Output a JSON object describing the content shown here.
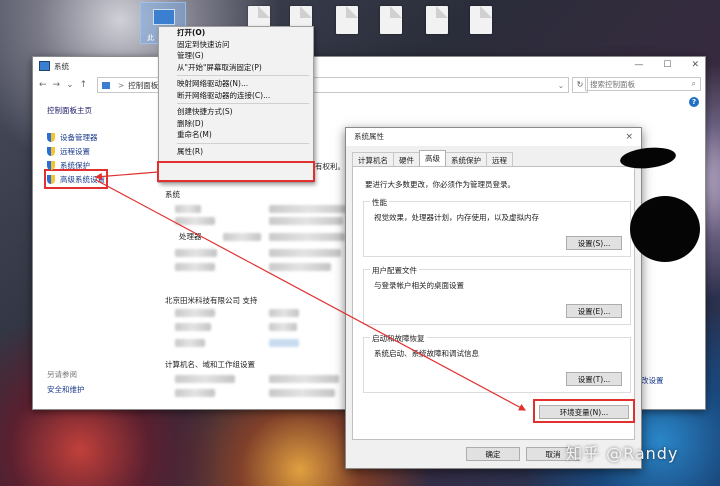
{
  "desktop": {
    "pc_label": "此"
  },
  "main_window": {
    "title": "系统",
    "address": {
      "root": "控制面板",
      "sep": ">"
    },
    "search_placeholder": "搜索控制面板",
    "sidebar": {
      "home": "控制面板主页",
      "items": [
        "设备管理器",
        "远程设置",
        "系统保护",
        "高级系统设置"
      ],
      "see_also": "另请参阅",
      "security": "安全和维护"
    },
    "content": {
      "rights_fragment": "有权利。",
      "system_heading": "系统",
      "processor_label": "处理器",
      "support_label": "北京田米科技有限公司 支持",
      "computer_heading": "计算机名、域和工作组设置",
      "change_settings_fragment": "改设置"
    }
  },
  "context_menu": {
    "items": [
      {
        "label": "打开(O)",
        "bold": true
      },
      {
        "label": "固定到快速访问"
      },
      {
        "label": "管理(G)"
      },
      {
        "label": "从\"开始\"屏幕取消固定(P)"
      },
      {
        "sep": true
      },
      {
        "label": "映射网络驱动器(N)..."
      },
      {
        "label": "断开网络驱动器的连接(C)..."
      },
      {
        "sep": true
      },
      {
        "label": "创建快捷方式(S)"
      },
      {
        "label": "删除(D)"
      },
      {
        "label": "重命名(M)"
      },
      {
        "sep": true
      },
      {
        "label": "属性(R)"
      }
    ]
  },
  "dialog": {
    "title": "系统属性",
    "close": "×",
    "tabs": [
      "计算机名",
      "硬件",
      "高级",
      "系统保护",
      "远程"
    ],
    "active_tab": "高级",
    "note": "要进行大多数更改，你必须作为管理员登录。",
    "performance": {
      "title": "性能",
      "desc": "视觉效果，处理器计划，内存使用，以及虚拟内存",
      "button": "设置(S)..."
    },
    "profile": {
      "title": "用户配置文件",
      "desc": "与登录帐户相关的桌面设置",
      "button": "设置(E)..."
    },
    "startup": {
      "title": "启动和故障恢复",
      "desc": "系统启动、系统故障和调试信息",
      "button": "设置(T)..."
    },
    "env_button": "环境变量(N)...",
    "ok": "确定",
    "cancel": "取消"
  },
  "watermark": "知乎 @Randy",
  "colors": {
    "highlight": "#e03030",
    "link": "#1a3a8a",
    "help": "#1f6fc5"
  }
}
